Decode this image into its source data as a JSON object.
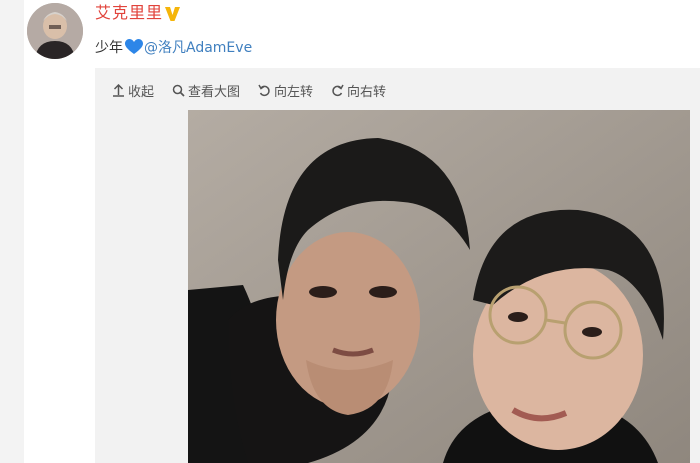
{
  "user": {
    "name": "艾克里里",
    "verified_icon": "vip-v-icon",
    "name_color": "#e1433b"
  },
  "post": {
    "text": "少年",
    "heart_icon": "blue-heart-icon",
    "mention": "@洛凡AdamEve",
    "mention_color": "#3f7fbf"
  },
  "toolbar": {
    "collapse_label": "收起",
    "view_large_label": "查看大图",
    "rotate_left_label": "向左转",
    "rotate_right_label": "向右转"
  }
}
